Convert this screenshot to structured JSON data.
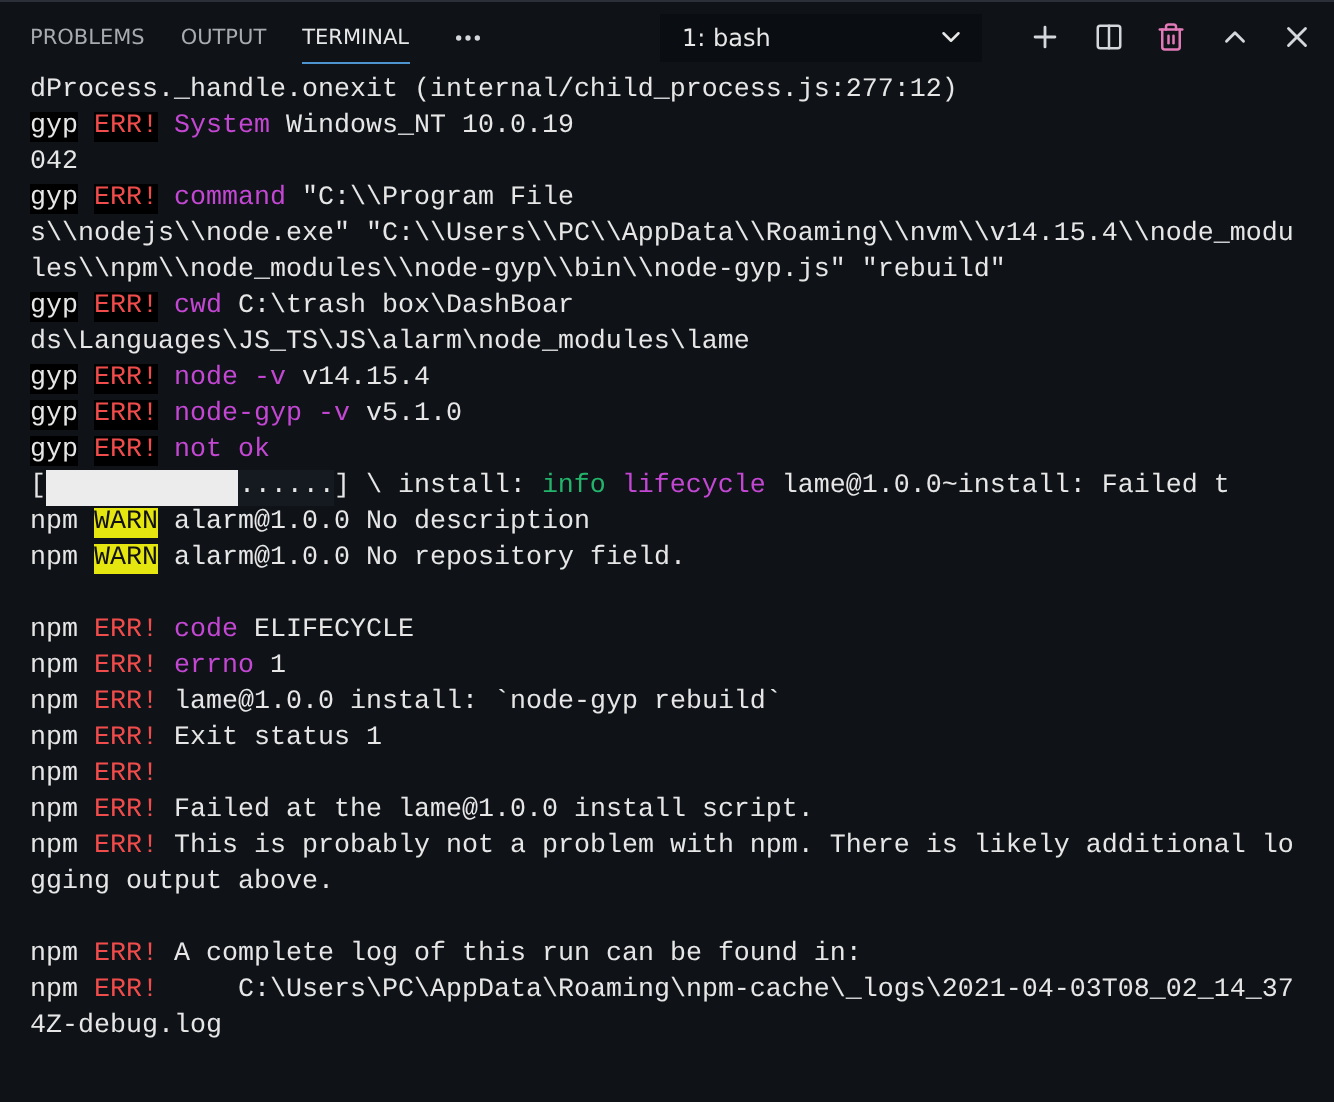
{
  "panel_tabs": [
    {
      "label": "PROBLEMS",
      "selected": false
    },
    {
      "label": "OUTPUT",
      "selected": false
    },
    {
      "label": "TERMINAL",
      "selected": true
    }
  ],
  "terminal_select": {
    "value": "1: bash"
  },
  "lines": [
    {
      "kind": "text",
      "segments": [
        {
          "kind": "plain",
          "text": "dProcess._handle.onexit (internal/child_process.js:277:12)"
        }
      ]
    },
    {
      "kind": "text",
      "segments": [
        {
          "kind": "prefix",
          "text": "gyp"
        },
        {
          "kind": "err-dark",
          "text": "ERR!"
        },
        {
          "kind": "key",
          "text": "System"
        },
        {
          "kind": "plain",
          "text": "Windows_NT 10.0.19"
        }
      ]
    },
    {
      "kind": "text",
      "segments": [
        {
          "kind": "plain",
          "text": "042"
        }
      ]
    },
    {
      "kind": "text",
      "segments": [
        {
          "kind": "prefix",
          "text": "gyp"
        },
        {
          "kind": "err-dark",
          "text": "ERR!"
        },
        {
          "kind": "key",
          "text": "command"
        },
        {
          "kind": "plain",
          "text": "\"C:\\\\Program File"
        }
      ]
    },
    {
      "kind": "text",
      "segments": [
        {
          "kind": "plain",
          "text": "s\\\\nodejs\\\\node.exe\" \"C:\\\\Users\\\\PC\\\\AppData\\\\Roaming\\\\nvm\\\\v14.15.4\\\\node_modu"
        }
      ]
    },
    {
      "kind": "text",
      "segments": [
        {
          "kind": "plain",
          "text": "les\\\\npm\\\\node_modules\\\\node-gyp\\\\bin\\\\node-gyp.js\" \"rebuild\""
        }
      ]
    },
    {
      "kind": "text",
      "segments": [
        {
          "kind": "prefix",
          "text": "gyp"
        },
        {
          "kind": "err-dark",
          "text": "ERR!"
        },
        {
          "kind": "key",
          "text": "cwd"
        },
        {
          "kind": "plain",
          "text": "C:\\trash box\\DashBoar"
        }
      ]
    },
    {
      "kind": "text",
      "segments": [
        {
          "kind": "plain",
          "text": "ds\\Languages\\JS_TS\\JS\\alarm\\node_modules\\lame"
        }
      ]
    },
    {
      "kind": "text",
      "segments": [
        {
          "kind": "prefix",
          "text": "gyp"
        },
        {
          "kind": "err-dark",
          "text": "ERR!"
        },
        {
          "kind": "key",
          "text": "node -v"
        },
        {
          "kind": "plain",
          "text": "v14.15.4"
        }
      ]
    },
    {
      "kind": "text",
      "segments": [
        {
          "kind": "prefix",
          "text": "gyp"
        },
        {
          "kind": "err-dark",
          "text": "ERR!"
        },
        {
          "kind": "key",
          "text": "node-gyp -v"
        },
        {
          "kind": "plain",
          "text": "v5.1.0"
        }
      ]
    },
    {
      "kind": "text",
      "segments": [
        {
          "kind": "prefix",
          "text": "gyp"
        },
        {
          "kind": "err-dark",
          "text": "ERR!"
        },
        {
          "kind": "key",
          "text": "not ok"
        }
      ]
    },
    {
      "kind": "progress",
      "open": "[",
      "level": 0.67,
      "dots": "......",
      "rest": "] \\ install:",
      "segments": [
        {
          "kind": "info",
          "text": "info"
        },
        {
          "kind": "key",
          "text": "lifecycle"
        },
        {
          "kind": "plain",
          "text": "lame@1.0.0~install: Failed t"
        }
      ]
    },
    {
      "kind": "text",
      "segments": [
        {
          "kind": "plain",
          "text": "npm"
        },
        {
          "kind": "warn",
          "text": "WARN"
        },
        {
          "kind": "plain",
          "text": "alarm@1.0.0 No description"
        }
      ]
    },
    {
      "kind": "text",
      "segments": [
        {
          "kind": "plain",
          "text": "npm"
        },
        {
          "kind": "warn",
          "text": "WARN"
        },
        {
          "kind": "plain",
          "text": "alarm@1.0.0 No repository field."
        }
      ]
    },
    {
      "kind": "blank"
    },
    {
      "kind": "text",
      "segments": [
        {
          "kind": "plain",
          "text": "npm"
        },
        {
          "kind": "err",
          "text": "ERR!"
        },
        {
          "kind": "key",
          "text": "code"
        },
        {
          "kind": "plain",
          "text": "ELIFECYCLE"
        }
      ]
    },
    {
      "kind": "text",
      "segments": [
        {
          "kind": "plain",
          "text": "npm"
        },
        {
          "kind": "err",
          "text": "ERR!"
        },
        {
          "kind": "key",
          "text": "errno"
        },
        {
          "kind": "plain",
          "text": "1"
        }
      ]
    },
    {
      "kind": "text",
      "segments": [
        {
          "kind": "plain",
          "text": "npm"
        },
        {
          "kind": "err",
          "text": "ERR!"
        },
        {
          "kind": "plain",
          "text": "lame@1.0.0 install: `node-gyp rebuild`"
        }
      ]
    },
    {
      "kind": "text",
      "segments": [
        {
          "kind": "plain",
          "text": "npm"
        },
        {
          "kind": "err",
          "text": "ERR!"
        },
        {
          "kind": "plain",
          "text": "Exit status 1"
        }
      ]
    },
    {
      "kind": "text",
      "segments": [
        {
          "kind": "plain",
          "text": "npm"
        },
        {
          "kind": "err",
          "text": "ERR!"
        }
      ]
    },
    {
      "kind": "text",
      "segments": [
        {
          "kind": "plain",
          "text": "npm"
        },
        {
          "kind": "err",
          "text": "ERR!"
        },
        {
          "kind": "plain",
          "text": "Failed at the lame@1.0.0 install script."
        }
      ]
    },
    {
      "kind": "text",
      "segments": [
        {
          "kind": "plain",
          "text": "npm"
        },
        {
          "kind": "err",
          "text": "ERR!"
        },
        {
          "kind": "plain",
          "text": "This is probably not a problem with npm. There is likely additional lo"
        }
      ]
    },
    {
      "kind": "text",
      "segments": [
        {
          "kind": "plain",
          "text": "gging output above."
        }
      ]
    },
    {
      "kind": "blank"
    },
    {
      "kind": "text",
      "segments": [
        {
          "kind": "plain",
          "text": "npm"
        },
        {
          "kind": "err",
          "text": "ERR!"
        },
        {
          "kind": "plain",
          "text": "A complete log of this run can be found in:"
        }
      ]
    },
    {
      "kind": "text",
      "segments": [
        {
          "kind": "plain",
          "text": "npm"
        },
        {
          "kind": "err",
          "text": "ERR!"
        },
        {
          "kind": "plain",
          "text": "    C:\\Users\\PC\\AppData\\Roaming\\npm-cache\\_logs\\2021-04-03T08_02_14_37"
        }
      ]
    },
    {
      "kind": "text",
      "segments": [
        {
          "kind": "plain",
          "text": "4Z-debug.log"
        }
      ]
    }
  ]
}
